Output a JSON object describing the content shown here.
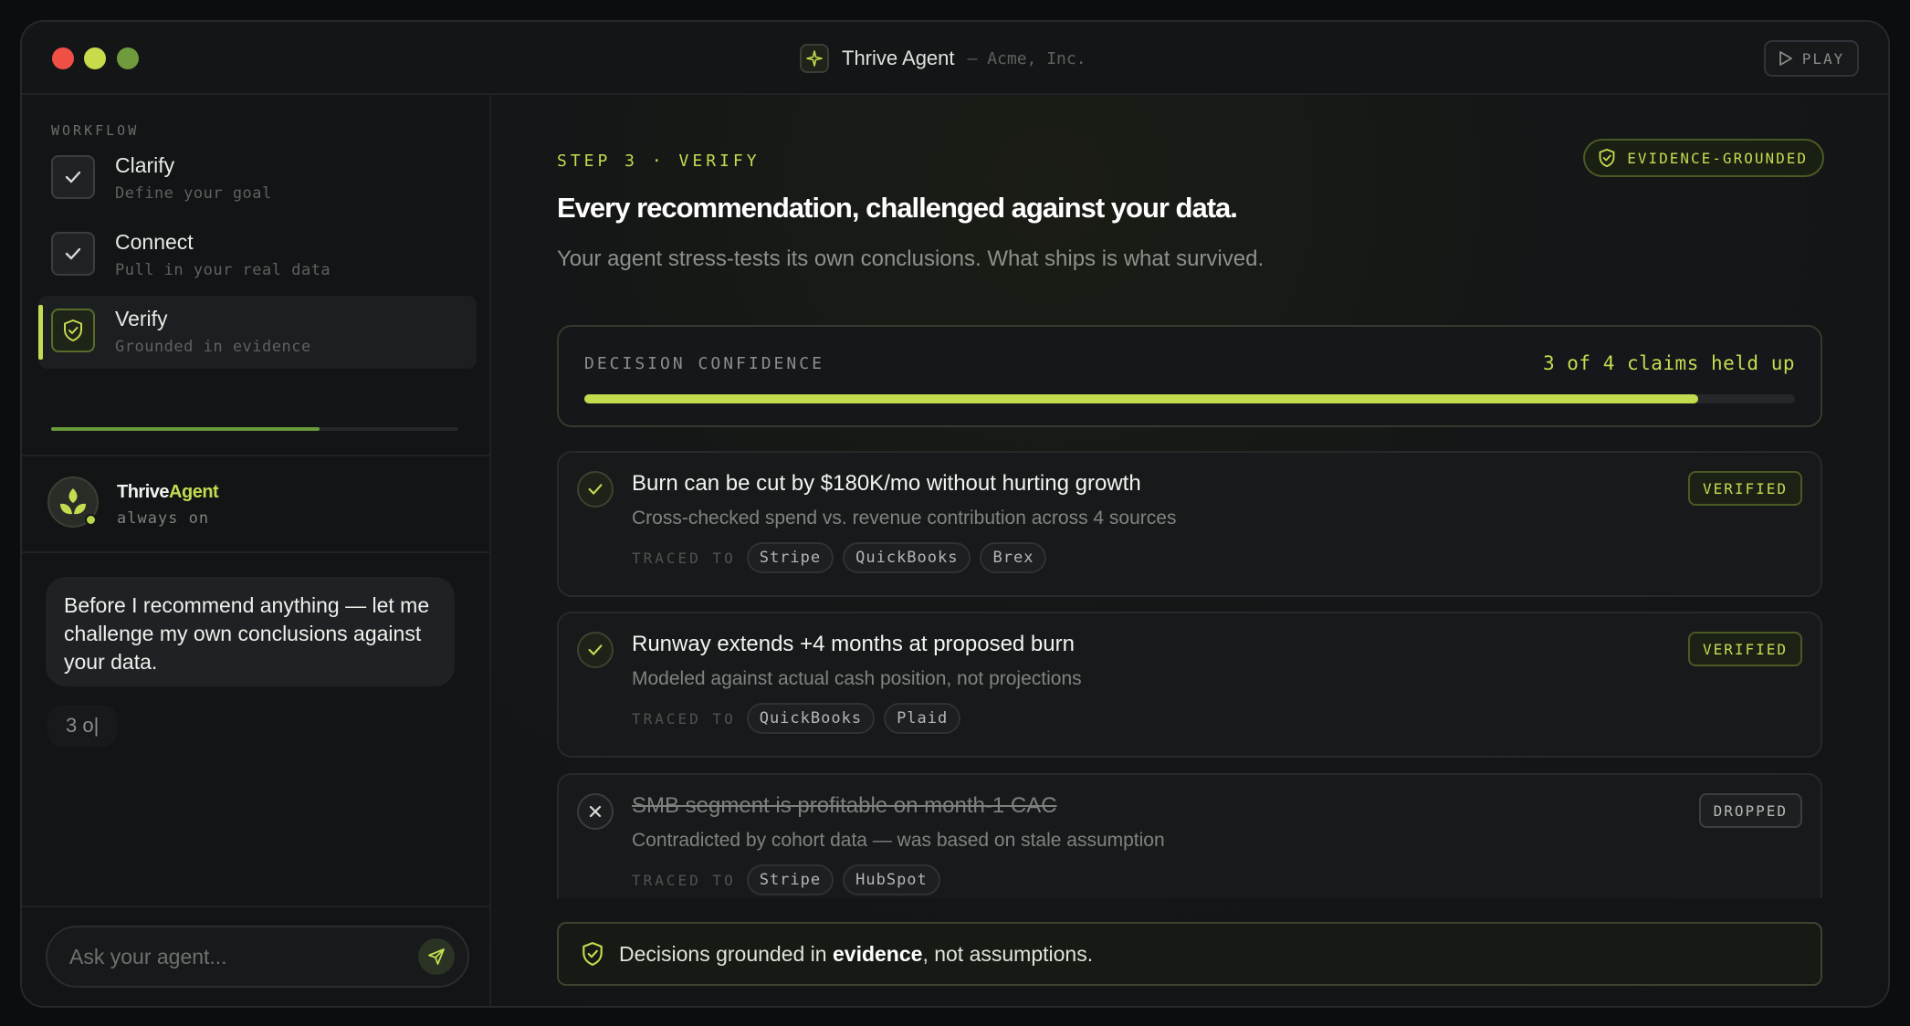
{
  "window": {
    "title": "Thrive Agent",
    "subtitle": "— Acme, Inc.",
    "play_label": "PLAY"
  },
  "sidebar": {
    "section_label": "WORKFLOW",
    "steps": [
      {
        "title": "Clarify",
        "subtitle": "Define your goal",
        "state": "done"
      },
      {
        "title": "Connect",
        "subtitle": "Pull in your real data",
        "state": "done"
      },
      {
        "title": "Verify",
        "subtitle": "Grounded in evidence",
        "state": "active"
      }
    ],
    "progress_fraction": 0.66,
    "agent": {
      "name_part1": "Thrive",
      "name_part2": "Agent",
      "status": "always on"
    },
    "message": "Before I recommend anything — let me challenge my own conclusions against your data.",
    "typing_text": "3 o|",
    "input_placeholder": "Ask your agent..."
  },
  "main": {
    "step_label": "STEP 3 · VERIFY",
    "badge": "EVIDENCE-GROUNDED",
    "headline": "Every recommendation, challenged against your data.",
    "subline": "Your agent stress-tests its own conclusions. What ships is what survived.",
    "confidence": {
      "label": "DECISION CONFIDENCE",
      "value_text": "3 of 4 claims held up",
      "fraction": 0.92
    },
    "traced_label": "TRACED TO",
    "claims": [
      {
        "title": "Burn can be cut by $180K/mo without hurting growth",
        "subtitle": "Cross-checked spend vs. revenue contribution across 4 sources",
        "sources": [
          "Stripe",
          "QuickBooks",
          "Brex"
        ],
        "verdict": "VERIFIED",
        "status": "verified"
      },
      {
        "title": "Runway extends +4 months at proposed burn",
        "subtitle": "Modeled against actual cash position, not projections",
        "sources": [
          "QuickBooks",
          "Plaid"
        ],
        "verdict": "VERIFIED",
        "status": "verified"
      },
      {
        "title": "SMB segment is profitable on month-1 CAC",
        "subtitle": "Contradicted by cohort data — was based on stale assumption",
        "sources": [
          "Stripe",
          "HubSpot"
        ],
        "verdict": "DROPPED",
        "status": "dropped"
      }
    ],
    "footer": {
      "before": "Decisions grounded in ",
      "emphasis": "evidence",
      "after": ", not assumptions."
    }
  },
  "colors": {
    "accent": "#c3dc4f",
    "background": "#121416",
    "dot_red": "#ef4f45",
    "dot_yellow": "#c8db4a",
    "dot_green": "#6f9b3c"
  },
  "icons": [
    "sparkle-icon",
    "play-icon",
    "check-icon",
    "shield-icon",
    "leaf-logo-icon",
    "send-icon",
    "close-icon"
  ]
}
